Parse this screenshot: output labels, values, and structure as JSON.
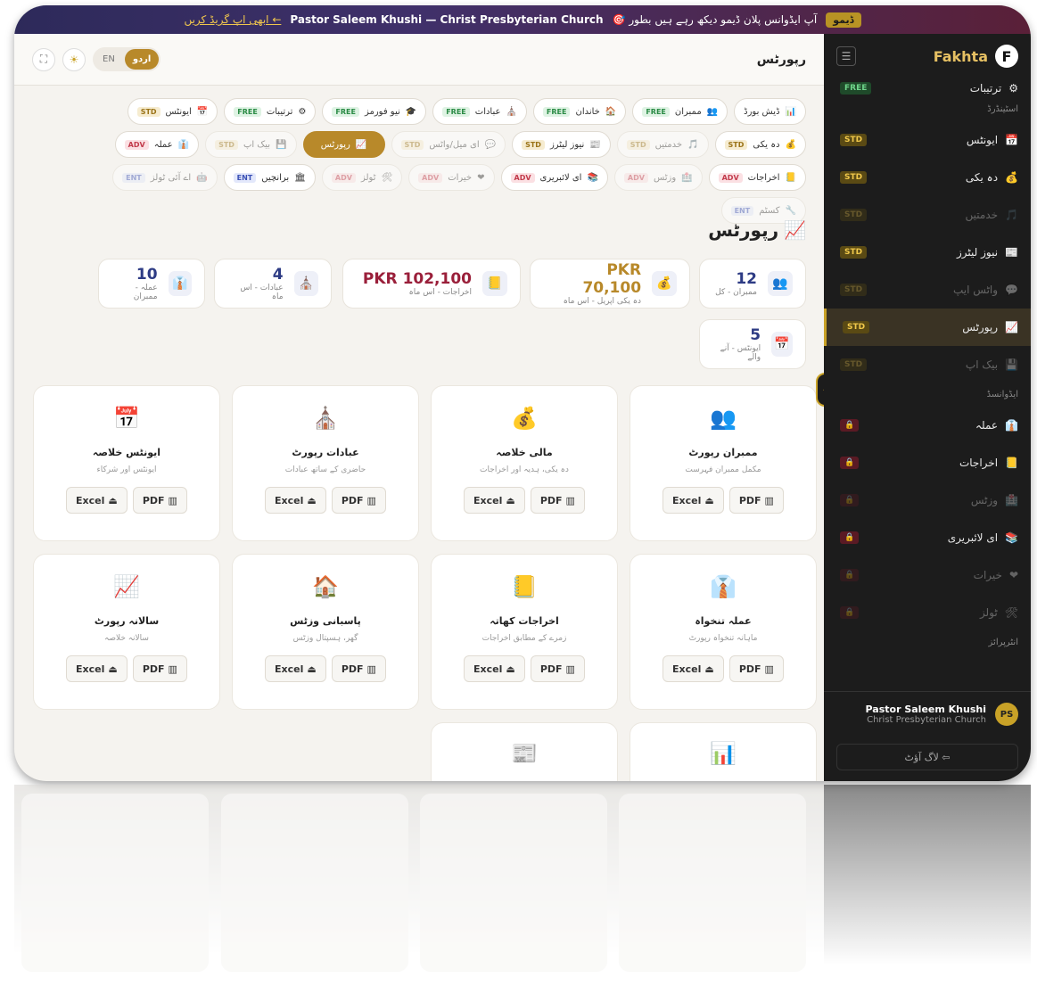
{
  "banner": {
    "tag": "ڈیمو",
    "text": "🎯 آپ ایڈوانس پلان ڈیمو دیکھ رہے ہیں بطور",
    "user": "Pastor Saleem Khushi — Christ Presbyterian Church",
    "link": "ابھی اپ گریڈ کریں ←"
  },
  "header": {
    "title": "رپورٹس",
    "lang_urdu": "اردو",
    "lang_en": "EN"
  },
  "sidebar": {
    "brand": "Fakhta",
    "logo": "F",
    "top_item": {
      "label": "ترتیبات",
      "badge": "FREE"
    },
    "section1": "اسٹینڈرڈ",
    "items1": [
      {
        "label": "ایونٹس",
        "badge": "STD",
        "dim": false
      },
      {
        "label": "دہ یکی",
        "badge": "STD",
        "dim": false
      },
      {
        "label": "خدمتیں",
        "badge": "STD",
        "dim": true
      },
      {
        "label": "نیوز لیٹرز",
        "badge": "STD",
        "dim": false
      },
      {
        "label": "واٹس ایپ",
        "badge": "STD",
        "dim": true
      },
      {
        "label": "رپورٹس",
        "badge": "STD",
        "dim": false,
        "active": true
      },
      {
        "label": "بیک اپ",
        "badge": "STD",
        "dim": true
      }
    ],
    "section2": "ایڈوانسڈ",
    "items2": [
      {
        "label": "عملہ",
        "dim": false
      },
      {
        "label": "اخراجات",
        "dim": false
      },
      {
        "label": "وزٹس",
        "dim": true
      },
      {
        "label": "ای لائبریری",
        "dim": false
      },
      {
        "label": "خیرات",
        "dim": true
      },
      {
        "label": "ٹولز",
        "dim": true
      }
    ],
    "section3": "انٹرپرائز",
    "user_name": "Pastor Saleem Khushi",
    "user_church": "Christ Presbyterian Church",
    "avatar": "PS",
    "logout": "لاگ آؤٹ ⇦"
  },
  "pills": [
    {
      "label": "ڈیش بورڈ",
      "badge": ""
    },
    {
      "label": "ممبران",
      "badge": "FREE"
    },
    {
      "label": "خاندان",
      "badge": "FREE"
    },
    {
      "label": "عبادات",
      "badge": "FREE"
    },
    {
      "label": "نیو فورمز",
      "badge": "FREE"
    },
    {
      "label": "ترتیبات",
      "badge": "FREE"
    },
    {
      "label": "ایونٹس",
      "badge": "STD"
    },
    {
      "label": "دہ یکی",
      "badge": "STD"
    },
    {
      "label": "خدمتیں",
      "badge": "STD",
      "dim": true
    },
    {
      "label": "نیوز لیٹرز",
      "badge": "STD"
    },
    {
      "label": "ای میل/واٹس",
      "badge": "STD",
      "dim": true
    },
    {
      "label": "رپورٹس",
      "badge": "",
      "active": true
    },
    {
      "label": "بیک اپ",
      "badge": "STD",
      "dim": true
    },
    {
      "label": "عملہ",
      "badge": "ADV"
    },
    {
      "label": "اخراجات",
      "badge": "ADV"
    },
    {
      "label": "وزٹس",
      "badge": "ADV",
      "dim": true
    },
    {
      "label": "ای لائبریری",
      "badge": "ADV"
    },
    {
      "label": "خیرات",
      "badge": "ADV",
      "dim": true
    },
    {
      "label": "ٹولز",
      "badge": "ADV",
      "dim": true
    },
    {
      "label": "برانچیں",
      "badge": "ENT"
    },
    {
      "label": "اے آئی ٹولز",
      "badge": "ENT",
      "dim": true
    },
    {
      "label": "کسٹم",
      "badge": "ENT",
      "dim": true
    }
  ],
  "page_title": "رپورٹس",
  "stats": [
    {
      "value": "12",
      "label": "ممبران - کل",
      "color": "blue",
      "icon": "👥"
    },
    {
      "value": "PKR 70,100",
      "label": "دہ یکی اپریل - اس ماہ",
      "color": "gold",
      "icon": "💰"
    },
    {
      "value": "PKR 102,100",
      "label": "اخراجات - اس ماہ",
      "color": "red",
      "icon": "📒"
    },
    {
      "value": "4",
      "label": "عبادات - اس ماہ",
      "color": "blue",
      "icon": "⛪"
    },
    {
      "value": "10",
      "label": "عملہ - ممبران",
      "color": "blue",
      "icon": "👔"
    },
    {
      "value": "5",
      "label": "ایونٹس - آنے والے",
      "color": "blue",
      "icon": "📅"
    }
  ],
  "cards": [
    {
      "title": "ممبران رپورٹ",
      "sub": "مکمل ممبران فہرست",
      "icon": "👥"
    },
    {
      "title": "مالی خلاصہ",
      "sub": "دہ یکی، ہدیہ اور اخراجات",
      "icon": "💰"
    },
    {
      "title": "عبادات رپورٹ",
      "sub": "حاضری کے ساتھ عبادات",
      "icon": "⛪"
    },
    {
      "title": "ایونٹس خلاصہ",
      "sub": "ایونٹس اور شرکاء",
      "icon": "📅"
    },
    {
      "title": "عملہ تنخواہ",
      "sub": "ماہانہ تنخواہ رپورٹ",
      "icon": "👔"
    },
    {
      "title": "اخراجات کھاتہ",
      "sub": "زمرے کے مطابق اخراجات",
      "icon": "📒"
    },
    {
      "title": "پاسبانی وزٹس",
      "sub": "گھر، ہسپتال وزٹس",
      "icon": "🏠"
    },
    {
      "title": "سالانہ رپورٹ",
      "sub": "سالانہ خلاصہ",
      "icon": "📈"
    },
    {
      "title": "",
      "sub": "",
      "icon": "📊"
    },
    {
      "title": "",
      "sub": "",
      "icon": "📰"
    }
  ],
  "btn_pdf": "PDF",
  "btn_excel": "Excel"
}
